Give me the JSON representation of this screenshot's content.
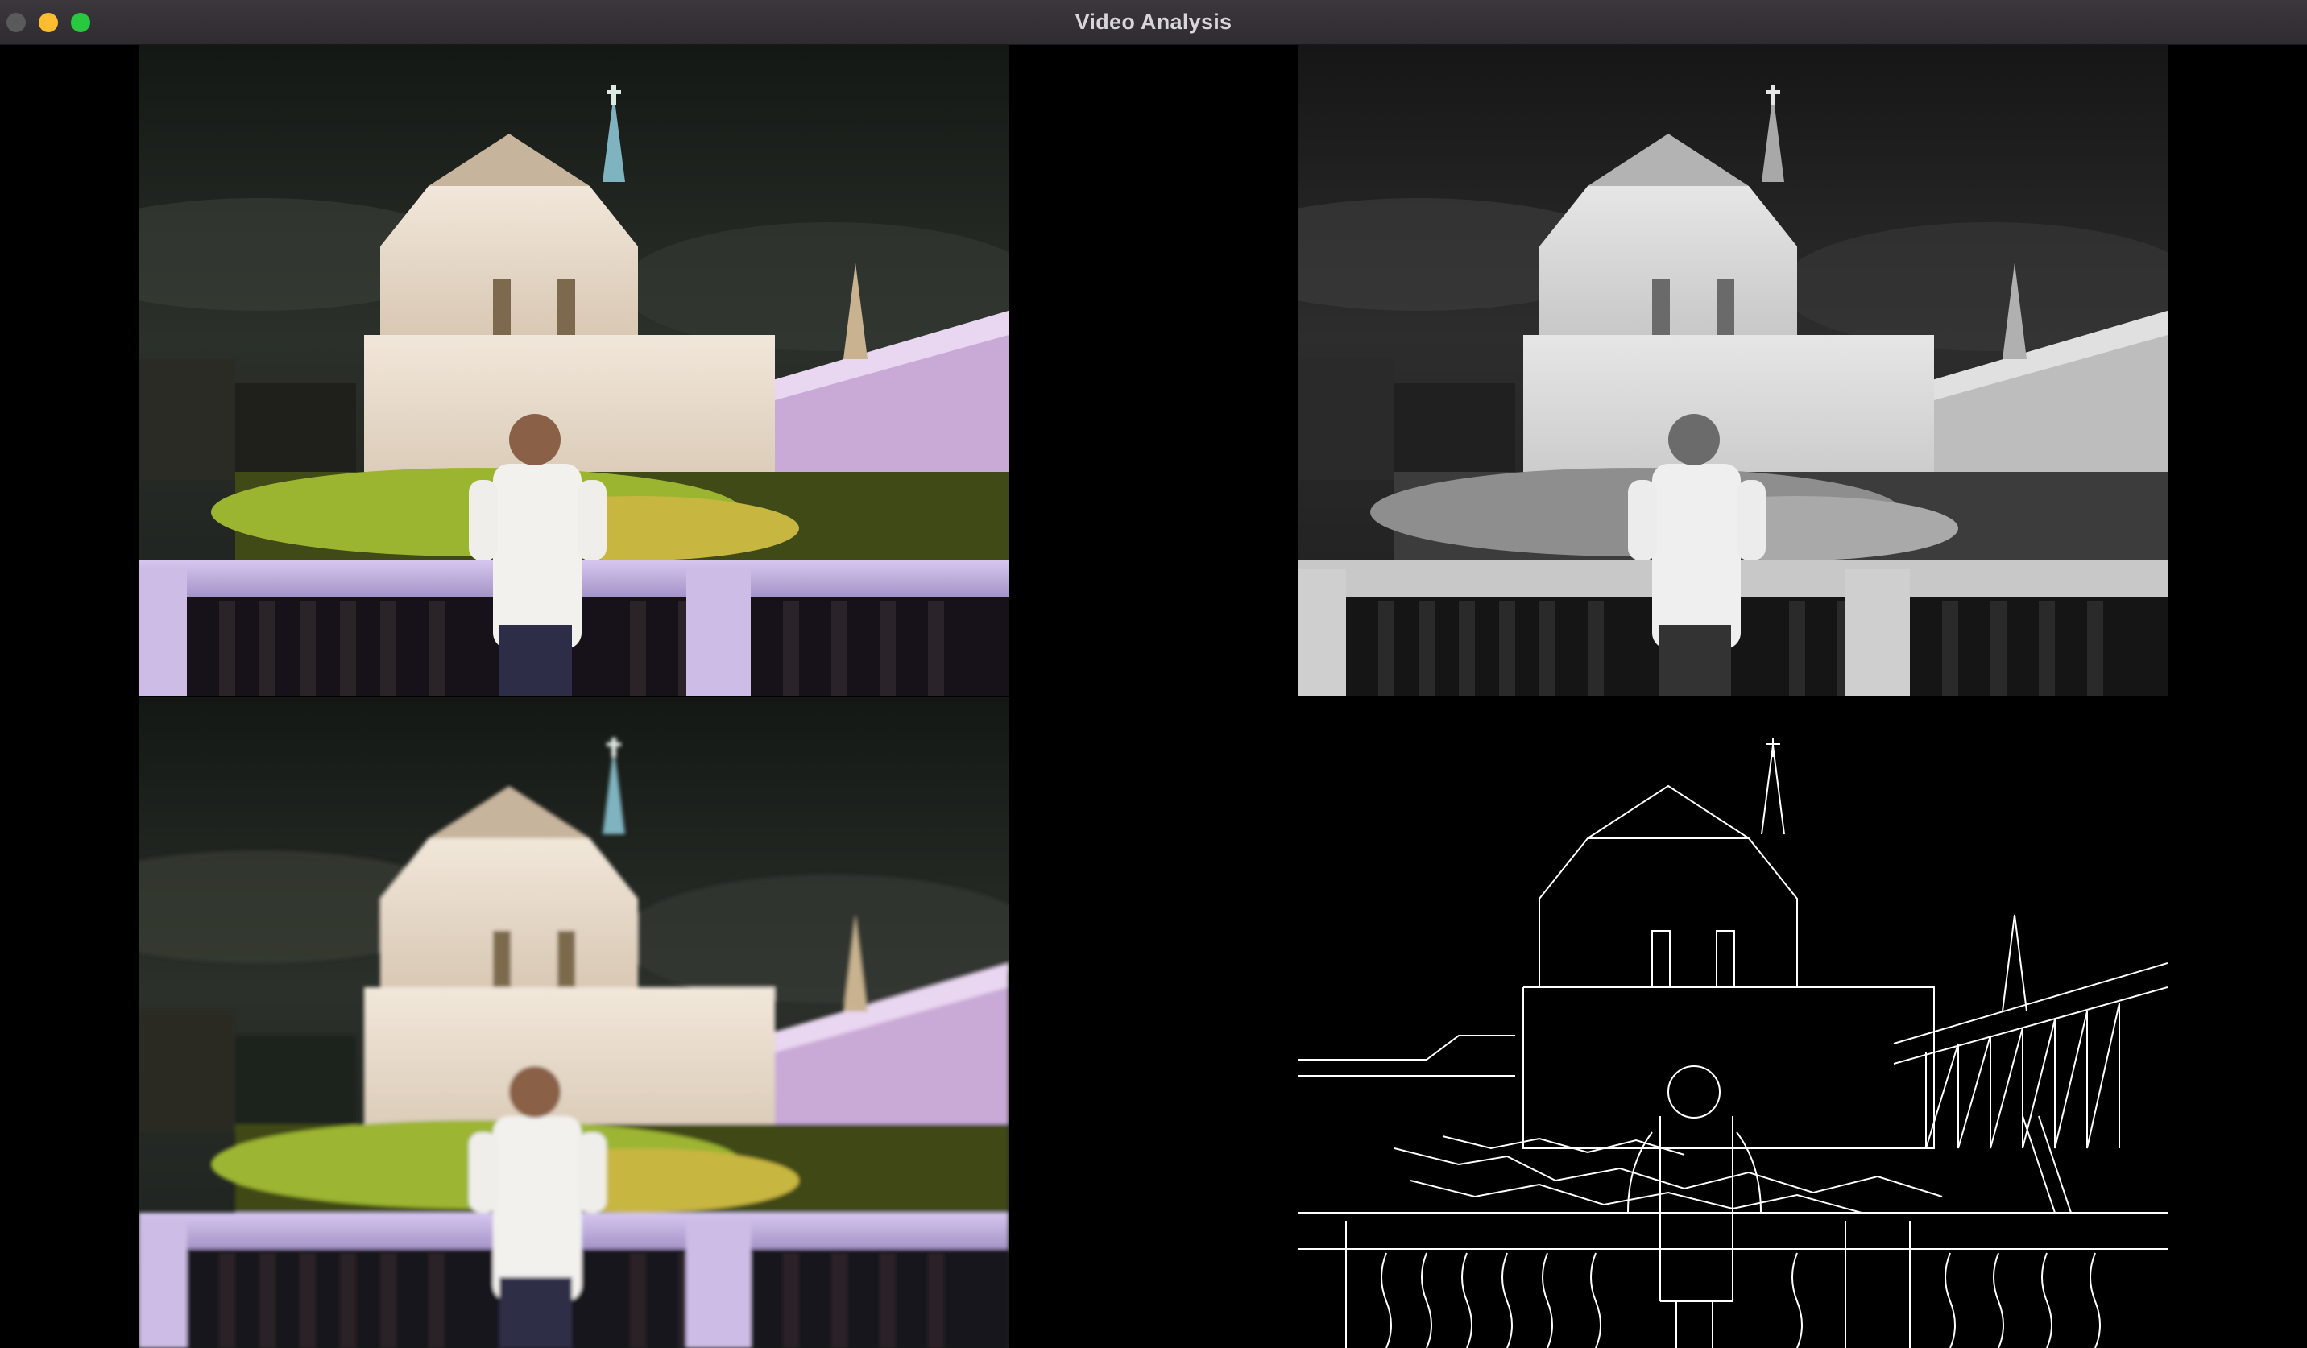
{
  "window": {
    "title": "Video Analysis",
    "controls": [
      "close-icon",
      "minimize-icon",
      "zoom-icon"
    ]
  },
  "panels": [
    {
      "id": "original",
      "kind": "color"
    },
    {
      "id": "grayscale",
      "kind": "gray"
    },
    {
      "id": "blurred",
      "kind": "color"
    },
    {
      "id": "edges",
      "kind": "edges"
    }
  ],
  "colors": {
    "titlebar": "#38343a",
    "sky": "#1f2420",
    "church": "#e9dfd2",
    "garden": "#8fa82a",
    "railing": "#c8b8e0",
    "edge_line": "#ffffff"
  }
}
